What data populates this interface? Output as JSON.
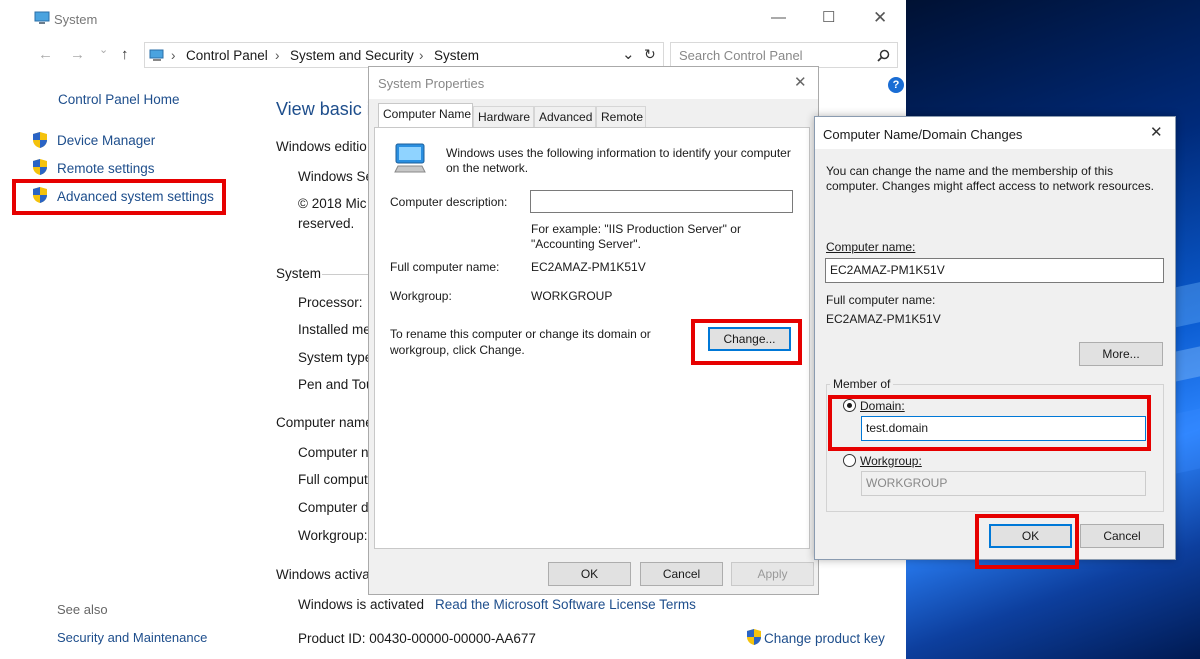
{
  "system_window": {
    "title": "System",
    "breadcrumbs": [
      "Control Panel",
      "System and Security",
      "System"
    ],
    "search_placeholder": "Search Control Panel",
    "help_label": "?",
    "sidebar": {
      "home": "Control Panel Home",
      "items": [
        "Device Manager",
        "Remote settings",
        "Advanced system settings"
      ],
      "see_also_heading": "See also",
      "see_also_items": [
        "Security and Maintenance"
      ]
    },
    "main": {
      "heading": "View basic i",
      "edition_heading": "Windows editio",
      "edition_line": "Windows Se",
      "copyright_1": "© 2018 Mic",
      "copyright_2": "reserved.",
      "system_heading": "System",
      "processor": "Processor:",
      "installed_mem": "Installed me",
      "system_type": "System type",
      "pen_touch": "Pen and Tou",
      "computer_name_heading": "Computer name",
      "computer_n": "Computer n",
      "full_comput": "Full comput",
      "computer_d": "Computer d",
      "workgroup": "Workgroup:",
      "activation_heading": "Windows activa",
      "activated_text": "Windows is activated",
      "license_link": "Read the Microsoft Software License Terms",
      "product_id": "Product ID: 00430-00000-00000-AA677",
      "change_key": "Change product key"
    }
  },
  "system_properties": {
    "title": "System Properties",
    "tabs": [
      "Computer Name",
      "Hardware",
      "Advanced",
      "Remote"
    ],
    "info": "Windows uses the following information to identify your computer on the network.",
    "description_label": "Computer description:",
    "description_value": "",
    "example_1": "For example: \"IIS Production Server\" or",
    "example_2": "\"Accounting Server\".",
    "full_name_label": "Full computer name:",
    "full_name_value": "EC2AMAZ-PM1K51V",
    "workgroup_label": "Workgroup:",
    "workgroup_value": "WORKGROUP",
    "rename_1": "To rename this computer or change its domain or",
    "rename_2": "workgroup, click Change.",
    "change_button": "Change...",
    "ok": "OK",
    "cancel": "Cancel",
    "apply": "Apply"
  },
  "name_domain_dialog": {
    "title": "Computer Name/Domain Changes",
    "info_1": "You can change the name and the membership of this",
    "info_2": "computer. Changes might affect access to network resources.",
    "computer_name_label": "Computer name:",
    "computer_name_value": "EC2AMAZ-PM1K51V",
    "full_name_label": "Full computer name:",
    "full_name_value": "EC2AMAZ-PM1K51V",
    "more_button": "More...",
    "member_of": "Member of",
    "domain_label": "Domain:",
    "domain_value": "test.domain",
    "workgroup_label": "Workgroup:",
    "workgroup_value": "WORKGROUP",
    "ok": "OK",
    "cancel": "Cancel",
    "selected_membership": "domain"
  },
  "colors": {
    "link": "#1e4e8c",
    "highlight": "#e60000",
    "focus": "#0078d7"
  }
}
